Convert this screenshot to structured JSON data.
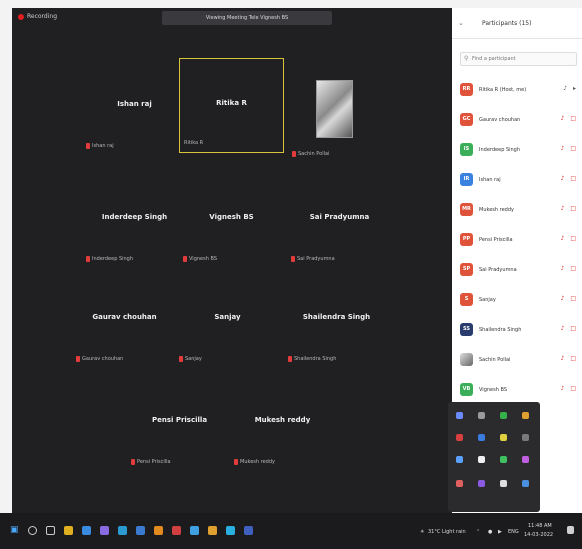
{
  "meeting": {
    "recording_label": "Recording",
    "title": "Viewing Meeting Tele Vignesh BS"
  },
  "tiles": [
    {
      "name": "Ishan raj",
      "label": "Ishan raj"
    },
    {
      "name": "Ritika R",
      "label": "Ritika R",
      "active": true
    },
    {
      "name": "",
      "label": "Sachin Pollai",
      "photo": true
    },
    {
      "name": "Inderdeep Singh",
      "label": "Inderdeep Singh"
    },
    {
      "name": "Vignesh BS",
      "label": "Vignesh BS"
    },
    {
      "name": "Sai Pradyumna",
      "label": "Sai Pradyumna"
    },
    {
      "name": "Gaurav chouhan",
      "label": "Gaurav chouhan"
    },
    {
      "name": "Sanjay",
      "label": "Sanjay"
    },
    {
      "name": "Shailendra Singh",
      "label": "Shailendra Singh"
    },
    {
      "name": "Pensi Priscilla",
      "label": "Pensi Priscilla"
    },
    {
      "name": "Mukesh reddy",
      "label": "Mukesh reddy"
    }
  ],
  "panel": {
    "title": "Participants (15)",
    "search_placeholder": "Find a participant",
    "participants": [
      {
        "initials": "RR",
        "name": "Ritika R (Host, me)",
        "color": "#e0533b",
        "icons": "♪ ▸"
      },
      {
        "initials": "GC",
        "name": "Gaurav chouhan",
        "color": "#e0533b",
        "icons": "♪ □"
      },
      {
        "initials": "IS",
        "name": "Inderdeep Singh",
        "color": "#3cae5a",
        "icons": "♪ □"
      },
      {
        "initials": "IR",
        "name": "Ishan raj",
        "color": "#3b82e0",
        "icons": "♪ □"
      },
      {
        "initials": "MR",
        "name": "Mukesh reddy",
        "color": "#e0533b",
        "icons": "♪ □"
      },
      {
        "initials": "PP",
        "name": "Pensi Priscilla",
        "color": "#e0533b",
        "icons": "♪ □"
      },
      {
        "initials": "SP",
        "name": "Sai Pradyumna",
        "color": "#e0533b",
        "icons": "♪ □"
      },
      {
        "initials": "S",
        "name": "Sanjay",
        "color": "#e0533b",
        "icons": "♪ □"
      },
      {
        "initials": "SS",
        "name": "Shailendra Singh",
        "color": "#2a3c6e",
        "icons": "♪ □"
      },
      {
        "initials": "",
        "name": "Sachin Pollai",
        "color": "photo",
        "icons": "♪ □"
      },
      {
        "initials": "VB",
        "name": "Vignesh BS",
        "color": "#3cae5a",
        "icons": "♪ □"
      }
    ]
  },
  "taskbar": {
    "weather": "31°C Light rain",
    "lang": "ENG",
    "time": "11:48 AM",
    "date": "14-03-2022"
  }
}
